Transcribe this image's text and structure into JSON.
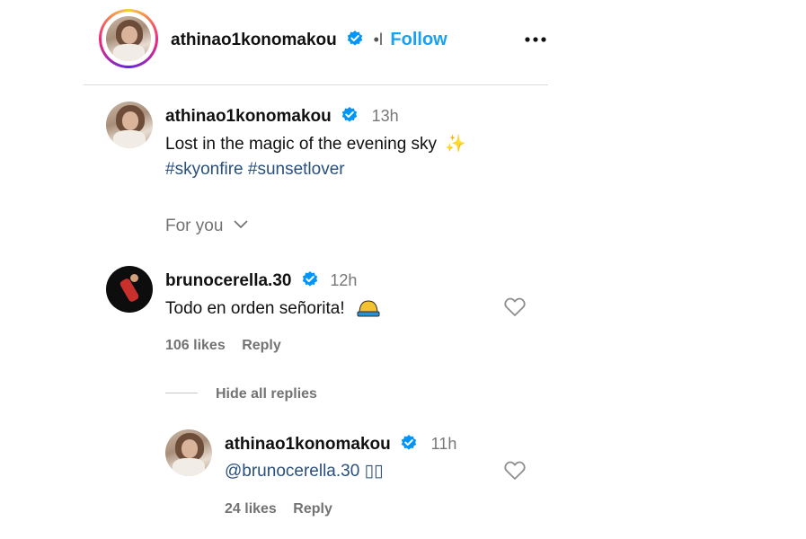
{
  "header": {
    "username": "athinao1konomakou",
    "separator": "•l",
    "follow_label": "Follow",
    "more_icon": "more-horizontal-icon"
  },
  "caption": {
    "username": "athinao1konomakou",
    "time": "13h",
    "text": "Lost in the magic of the evening sky",
    "emoji": "✨",
    "hashtags": "#skyonfire #sunsetlover"
  },
  "for_you": {
    "label": "For you"
  },
  "comments": [
    {
      "username": "brunocerella.30",
      "time": "12h",
      "text": "Todo en orden señorita!",
      "emoji": "⛑",
      "likes": "106 likes",
      "reply_label": "Reply",
      "hide_replies_label": "Hide all replies",
      "replies": [
        {
          "username": "athinao1konomakou",
          "time": "11h",
          "text": "@brunocerella.30 ▯▯",
          "likes": "24 likes",
          "reply_label": "Reply"
        }
      ]
    }
  ],
  "colors": {
    "verified": "#0095f6",
    "follow": "#1aa0f0",
    "hashtag": "#2a4f7a",
    "meta": "#737373",
    "divider": "#dbdbdb"
  }
}
